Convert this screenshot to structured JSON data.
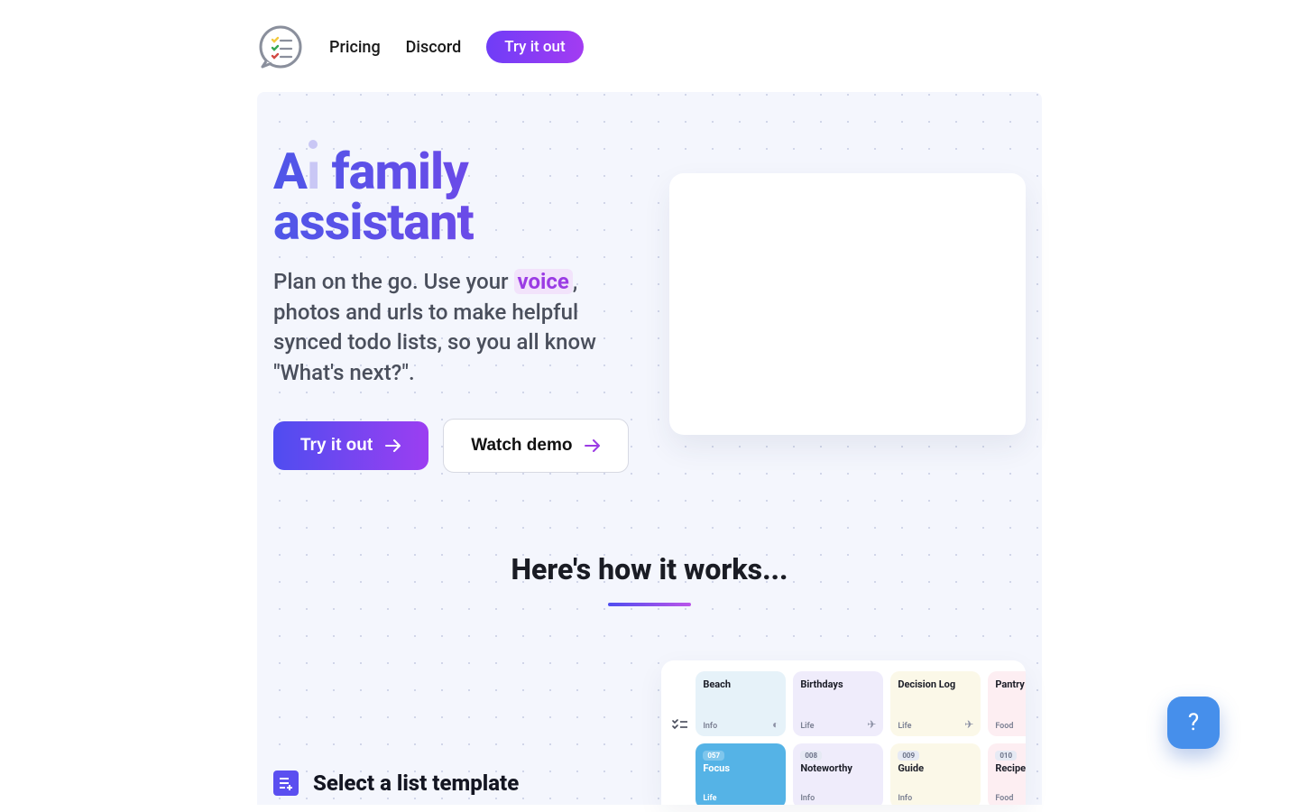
{
  "nav": {
    "links": [
      "Pricing",
      "Discord"
    ],
    "try_label": "Try it out"
  },
  "hero": {
    "title_ai": "A",
    "title_rest": " family assistant",
    "sub_before": "Plan on the go. Use your ",
    "sub_voice": "voice",
    "sub_after": ", photos and urls to make helpful synced todo lists, so you all know \"What's next?\".",
    "cta_primary": "Try it out",
    "cta_secondary": "Watch demo"
  },
  "how": {
    "heading": "Here's how it works..."
  },
  "step1": {
    "title": "Select a list template"
  },
  "templates": [
    {
      "name": "Beach",
      "cat": "Info",
      "bg": "bg-blue",
      "corner": "ball"
    },
    {
      "name": "Birthdays",
      "cat": "Life",
      "bg": "bg-lilac",
      "corner": "rocket"
    },
    {
      "name": "Decision Log",
      "cat": "Life",
      "bg": "bg-cream",
      "corner": "rocket"
    },
    {
      "name": "Pantry",
      "cat": "Food",
      "bg": "bg-pink",
      "corner": ""
    },
    {
      "name": "Focus",
      "cat": "Life",
      "bg": "bg-sky",
      "badge": "057"
    },
    {
      "name": "Noteworthy",
      "cat": "Info",
      "bg": "bg-lilac",
      "badge": "008"
    },
    {
      "name": "Guide",
      "cat": "Info",
      "bg": "bg-cream",
      "badge": "009"
    },
    {
      "name": "Recipe",
      "cat": "Food",
      "bg": "bg-pink",
      "badge": "010"
    }
  ],
  "icons": {
    "logo": "chat-list-icon",
    "arrow": "arrow-right-icon",
    "step": "list-plus-icon",
    "help": "question-icon",
    "checklist": "checklist-icon"
  },
  "colors": {
    "gradient_from": "#4f4df0",
    "gradient_to": "#9c3ef1",
    "accent_purple": "#9b3be4",
    "help_blue": "#468feb"
  }
}
